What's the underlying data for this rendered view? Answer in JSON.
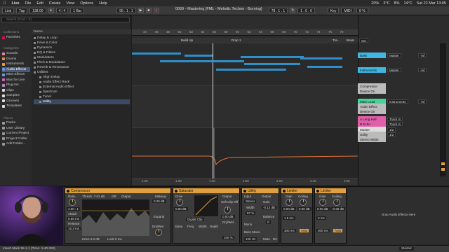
{
  "menubar": {
    "app": "Live",
    "items": [
      "File",
      "Edit",
      "Create",
      "View",
      "Options",
      "Help"
    ],
    "clock": "Sat 22 Mar 13:05",
    "readouts": [
      "20%",
      "3°C",
      "8%",
      "14°C"
    ]
  },
  "window_title": "0069 - Mastering [FML - Melodic Techno - Burning]",
  "transport": {
    "link": "Link",
    "tap": "Tap",
    "tempo": "138.00",
    "signature": "4 / 4",
    "quantize": "1 Bar",
    "position": "55 .  1 .  1",
    "loop_start": "78 .  1 .  1",
    "loop_length": "1 .  0 .  0",
    "key": "Key",
    "midi": "MIDI",
    "cpu": "8 %"
  },
  "browser": {
    "search_placeholder": "Search (Cmd + F)",
    "collections_label": "Collections",
    "favorites": "Favorites",
    "categories_label": "Categories",
    "categories": [
      "Sounds",
      "Drums",
      "Instruments",
      "Audio Effects",
      "MIDI Effects",
      "Max for Live",
      "Plug-Ins",
      "Clips",
      "Samples",
      "Grooves",
      "Templates"
    ],
    "places_label": "Places",
    "places": [
      "Packs",
      "User Library",
      "Current Project",
      "Project Folder",
      "Add Folder..."
    ],
    "name_header": "Name",
    "files": [
      "Delay & Loop",
      "Drive & Color",
      "Dynamics",
      "EQ & Filters",
      "Modulators",
      "Pitch & Modulation",
      "Reverb & Resonance",
      "Utilities",
      "Align Delay",
      "Audio Effect Rack",
      "External Audio Effect",
      "Spectrum",
      "Tuner",
      "Utility"
    ]
  },
  "arrangement": {
    "ruler": [
      "44",
      "46",
      "48",
      "50",
      "52",
      "54",
      "56",
      "58",
      "60",
      "62",
      "64",
      "66",
      "68",
      "70",
      "72",
      "74",
      "76",
      "78"
    ],
    "locators": [
      "Build Up",
      "Drop 1",
      "Tra...",
      "Breat"
    ],
    "time_ticks": [
      "1:20",
      "1:30",
      "1:40",
      "1:50",
      "2:00",
      "2:10",
      "2:20"
    ]
  },
  "tracks": {
    "set_label": "Set",
    "rows": [
      {
        "name": "Bass",
        "color": "#3fb7e0",
        "out": "Master",
        "vol": "-inf"
      },
      {
        "name": "Instruments",
        "color": "#3fb7e0",
        "out": "Master",
        "vol": "-inf"
      },
      {
        "name": "Compressor",
        "color": "#bbbbbb",
        "out": "",
        "vol": ""
      },
      {
        "name": "Device On",
        "color": "#bbbbbb",
        "out": "",
        "vol": ""
      },
      {
        "name": "Main Lead",
        "color": "#46d39a",
        "out": "Instruments",
        "vol": "-inf"
      },
      {
        "name": "Audio Effect",
        "color": "#bbbbbb",
        "out": "",
        "vol": ""
      },
      {
        "name": "Device On",
        "color": "#bbbbbb",
        "out": "",
        "vol": ""
      },
      {
        "name": "A Long Hall",
        "color": "#e05fa8",
        "out": "Track In",
        "vol": ""
      },
      {
        "name": "B Echo",
        "color": "#e05fa8",
        "out": "Track In",
        "vol": ""
      },
      {
        "name": "Master",
        "color": "#dddddd",
        "out": "1/2",
        "vol": ""
      },
      {
        "name": "Utility",
        "color": "#bbbbbb",
        "out": "1/2",
        "vol": ""
      },
      {
        "name": "Stereo Width",
        "color": "#bbbbbb",
        "out": "",
        "vol": ""
      }
    ]
  },
  "devices": {
    "compressor": {
      "title": "Compressor",
      "ratio_label": "Ratio",
      "ratio": "4.00 : 1",
      "attack_label": "Attack",
      "attack": "0.55 ms",
      "release_label": "Release",
      "release": "15.3 ms",
      "thresh": "Thresh -7.01 dB",
      "gr": "GR",
      "output": "Output",
      "makeup": "Makeup",
      "makeup_val": "0.00 dB",
      "expand": "Expand",
      "drywet": "Dry/Wet",
      "knee": "Knee 6.0 dB",
      "lookahead": "Look 0 ms"
    },
    "saturator": {
      "title": "Saturator",
      "drive_label": "Drive",
      "drive": "0.00 dB",
      "type": "Digital Clip",
      "output_label": "Output",
      "output": "0.00 dB",
      "softclip": "Soft Clip Off",
      "drywet": "Dry/Wet",
      "drywet_val": "100 %",
      "base": "Base",
      "freq": "Freq",
      "width": "Width",
      "depth": "Depth"
    },
    "utility": {
      "title": "Utility",
      "input_label": "Input",
      "output_label": "Output",
      "stereo": "Stereo",
      "width_label": "Width",
      "width": "87 %",
      "mono": "Mono",
      "bass_mono": "Bass Mono",
      "bass_freq": "120 Hz",
      "gain_label": "Gain",
      "gain": "-0.12 dB",
      "balance_label": "Balance",
      "balance": "0",
      "mute": "Mute",
      "dc": "DC"
    },
    "limiter1": {
      "title": "Limiter",
      "gain_label": "Gain",
      "gain": "0.00 dB",
      "ceiling_label": "Ceiling",
      "ceiling": "0.00 dB",
      "lookahead": "1.5 ms",
      "release": "300 ms",
      "auto": "Auto"
    },
    "limiter2": {
      "title": "Limiter",
      "gain_label": "Gain",
      "gain": "0.00 dB",
      "ceiling_label": "Ceiling",
      "ceiling": "-0.30 dB",
      "lookahead": "3 ms",
      "release": "300 ms",
      "auto": "Auto"
    },
    "drop_hint": "Drop Audio Effects Here"
  },
  "status": {
    "message": "Insert Mark 55.1.1 (Time: 1:40.290)",
    "track": "Master"
  }
}
